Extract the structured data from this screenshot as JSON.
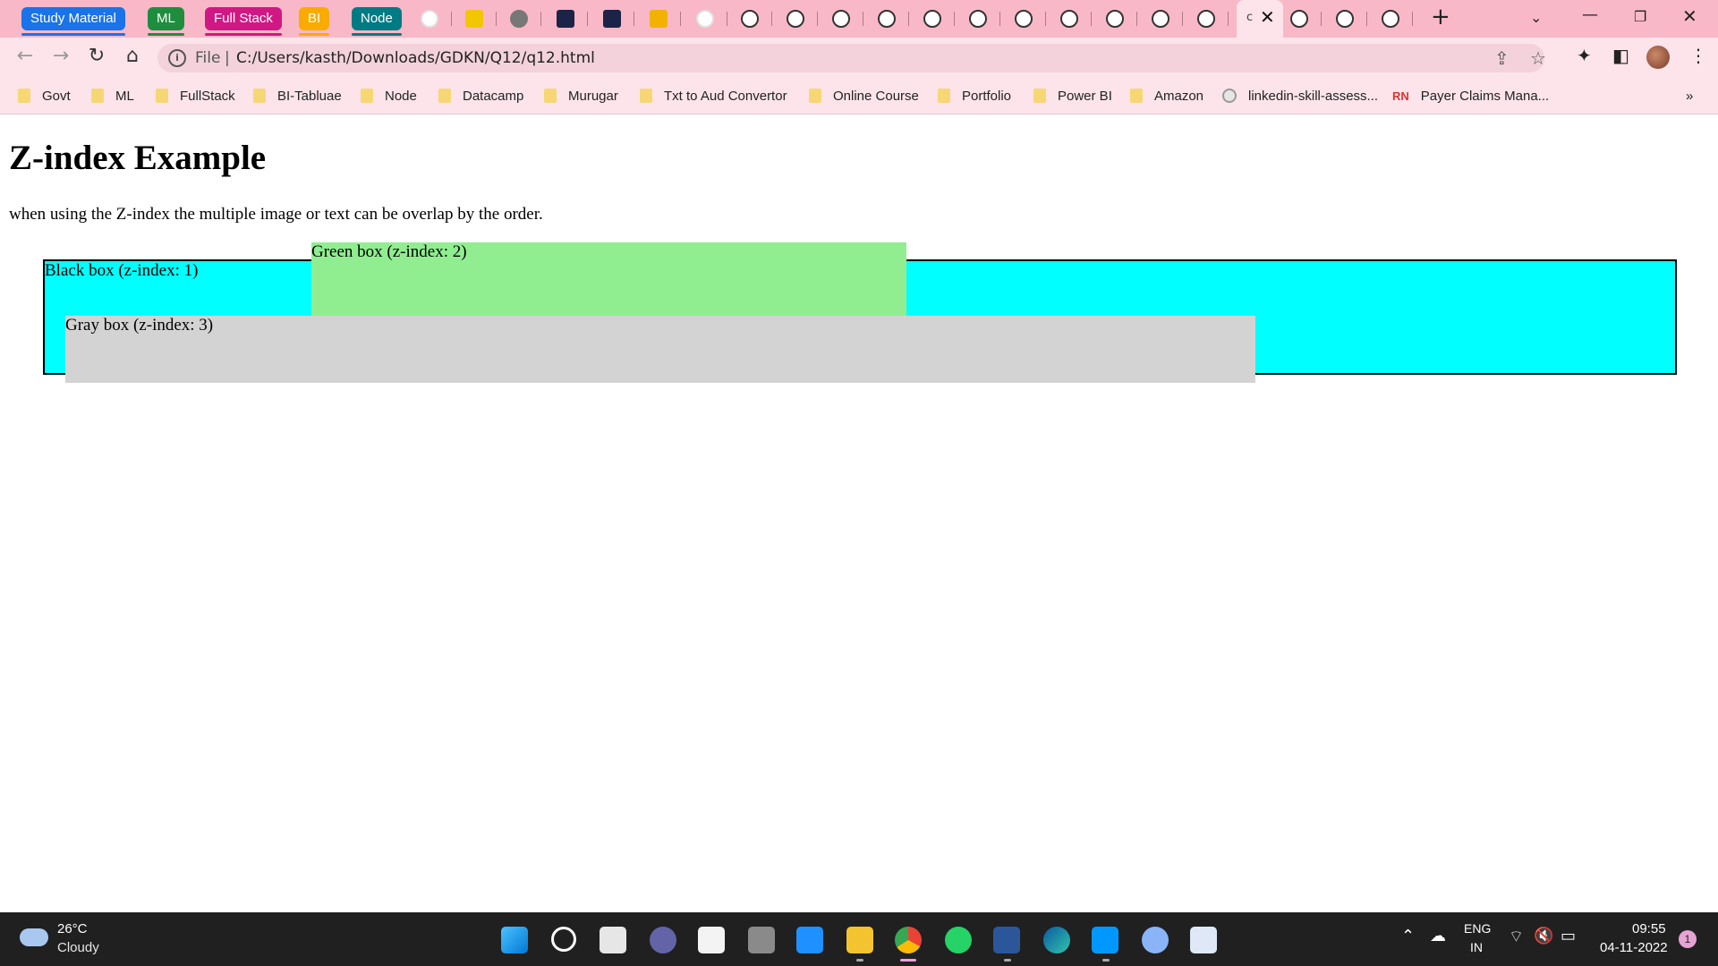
{
  "browser": {
    "tab_groups": [
      {
        "label": "Study Material",
        "color": "#1a73e8"
      },
      {
        "label": "ML",
        "color": "#1e8e3e"
      },
      {
        "label": "Full Stack",
        "color": "#d01884"
      },
      {
        "label": "BI",
        "color": "#f9ab00"
      },
      {
        "label": "Node",
        "color": "#007b83"
      }
    ],
    "active_tab_letter": "c",
    "new_tab_symbol": "+",
    "address": {
      "scheme_label": "File",
      "url": "C:/Users/kasth/Downloads/GDKN/Q12/q12.html"
    },
    "bookmarks": [
      {
        "label": "Govt",
        "icon": "folder-icon"
      },
      {
        "label": "ML",
        "icon": "folder-icon"
      },
      {
        "label": "FullStack",
        "icon": "folder-icon"
      },
      {
        "label": "BI-Tabluae",
        "icon": "folder-icon"
      },
      {
        "label": "Node",
        "icon": "folder-icon"
      },
      {
        "label": "Datacamp",
        "icon": "folder-icon"
      },
      {
        "label": "Murugar",
        "icon": "folder-icon"
      },
      {
        "label": "Txt to Aud Convertor",
        "icon": "folder-icon"
      },
      {
        "label": "Online Course",
        "icon": "folder-icon"
      },
      {
        "label": "Portfolio",
        "icon": "folder-icon"
      },
      {
        "label": "Power BI",
        "icon": "folder-icon"
      },
      {
        "label": "Amazon",
        "icon": "folder-icon"
      },
      {
        "label": "linkedin-skill-assess...",
        "icon": "github-icon"
      },
      {
        "label": "Payer Claims Mana...",
        "icon": "rn-icon"
      }
    ],
    "bookmarks_overflow": "»"
  },
  "page": {
    "title": "Z-index Example",
    "description": "when using the Z-index the multiple image or text can be overlap by the order.",
    "boxes": {
      "black": {
        "label": "Black box (z-index: 1)",
        "color": "#00ffff"
      },
      "green": {
        "label": "Green box (z-index: 2)",
        "color": "#90ee90"
      },
      "gray": {
        "label": "Gray box (z-index: 3)",
        "color": "#d3d3d3"
      }
    }
  },
  "taskbar": {
    "weather": {
      "temp": "26°C",
      "condition": "Cloudy"
    },
    "language": {
      "line1": "ENG",
      "line2": "IN"
    },
    "clock": {
      "time": "09:55",
      "date": "04-11-2022"
    },
    "notification_count": "1"
  }
}
